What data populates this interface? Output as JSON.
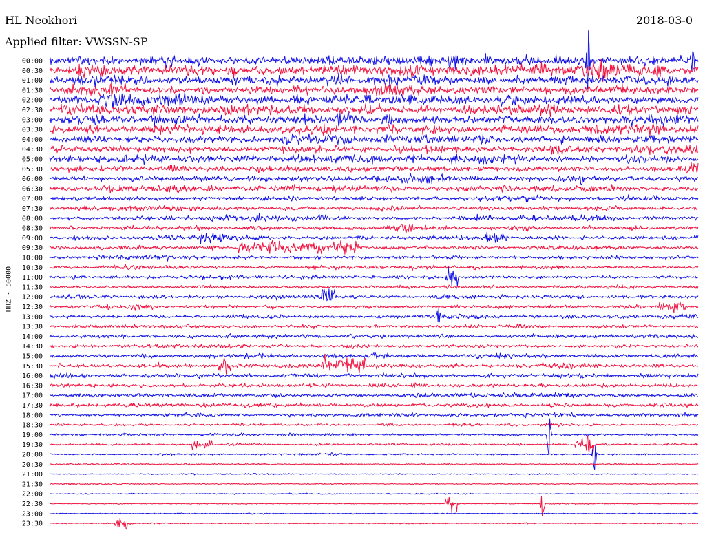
{
  "header": {
    "station": "HL Neokhori",
    "date": "2018-03-0",
    "filter": "Applied filter: VWSSN-SP"
  },
  "channel_label": "HHZ - 50000",
  "colors": {
    "trace_a": "#1212e6",
    "trace_b": "#f0123f",
    "background": "#ffffff"
  },
  "chart_data": {
    "type": "line",
    "title": "HL Neokhori",
    "subtitle": "Applied filter: VWSSN-SP",
    "ylabel": "HHZ - 50000",
    "row_labels": [
      "00:00",
      "00:30",
      "01:00",
      "01:30",
      "02:00",
      "02:30",
      "03:00",
      "03:30",
      "04:00",
      "04:30",
      "05:00",
      "05:30",
      "06:00",
      "06:30",
      "07:00",
      "07:30",
      "08:00",
      "08:30",
      "09:00",
      "09:30",
      "10:00",
      "10:30",
      "11:00",
      "11:30",
      "12:00",
      "12:30",
      "13:00",
      "13:30",
      "14:00",
      "14:30",
      "15:00",
      "15:30",
      "16:00",
      "16:30",
      "17:00",
      "17:30",
      "18:00",
      "18:30",
      "19:00",
      "19:30",
      "20:00",
      "20:30",
      "21:00",
      "21:30",
      "22:00",
      "22:30",
      "23:00",
      "23:30"
    ],
    "series_colors": [
      "#1212e6",
      "#f0123f"
    ],
    "row_amplitude_level": [
      1.0,
      1.0,
      0.95,
      0.95,
      0.95,
      0.9,
      0.9,
      0.85,
      0.8,
      0.75,
      0.7,
      0.65,
      0.6,
      0.55,
      0.45,
      0.45,
      0.42,
      0.4,
      0.4,
      0.4,
      0.35,
      0.35,
      0.35,
      0.35,
      0.35,
      0.35,
      0.35,
      0.35,
      0.35,
      0.35,
      0.4,
      0.45,
      0.45,
      0.4,
      0.35,
      0.35,
      0.3,
      0.25,
      0.22,
      0.2,
      0.18,
      0.15,
      0.12,
      0.12,
      0.1,
      0.1,
      0.1,
      0.1
    ],
    "events": [
      {
        "row": "09:30",
        "start": 0.29,
        "end": 0.48,
        "amplitude": 1.3
      },
      {
        "row": "09:00",
        "start": 0.23,
        "end": 0.27,
        "amplitude": 1.0
      },
      {
        "row": "09:00",
        "start": 0.67,
        "end": 0.71,
        "amplitude": 1.0
      },
      {
        "row": "08:30",
        "start": 0.52,
        "end": 0.56,
        "amplitude": 1.0
      },
      {
        "row": "11:00",
        "start": 0.61,
        "end": 0.63,
        "amplitude": 2.5
      },
      {
        "row": "12:00",
        "start": 0.42,
        "end": 0.44,
        "amplitude": 2.0
      },
      {
        "row": "12:30",
        "start": 0.94,
        "end": 0.98,
        "amplitude": 1.5
      },
      {
        "row": "15:30",
        "start": 0.42,
        "end": 0.49,
        "amplitude": 2.0
      },
      {
        "row": "15:30",
        "start": 0.26,
        "end": 0.28,
        "amplitude": 2.5
      },
      {
        "row": "19:30",
        "start": 0.22,
        "end": 0.25,
        "amplitude": 1.5
      },
      {
        "row": "19:30",
        "start": 0.81,
        "end": 0.84,
        "amplitude": 2.5
      },
      {
        "row": "22:30",
        "start": 0.61,
        "end": 0.63,
        "amplitude": 2.5
      },
      {
        "row": "23:30",
        "start": 0.1,
        "end": 0.12,
        "amplitude": 2.0
      }
    ],
    "spikes": [
      {
        "row": "00:00",
        "x": 0.83,
        "amplitude": 12
      },
      {
        "row": "00:00",
        "x": 0.99,
        "amplitude": 3
      },
      {
        "row": "06:00",
        "x": 0.82,
        "amplitude": 3
      },
      {
        "row": "19:00",
        "x": 0.77,
        "amplitude": 8
      },
      {
        "row": "19:30",
        "x": 0.83,
        "amplitude": 6
      },
      {
        "row": "20:00",
        "x": 0.84,
        "amplitude": 6
      },
      {
        "row": "22:30",
        "x": 0.76,
        "amplitude": 5
      },
      {
        "row": "13:00",
        "x": 0.6,
        "amplitude": 4
      }
    ]
  }
}
